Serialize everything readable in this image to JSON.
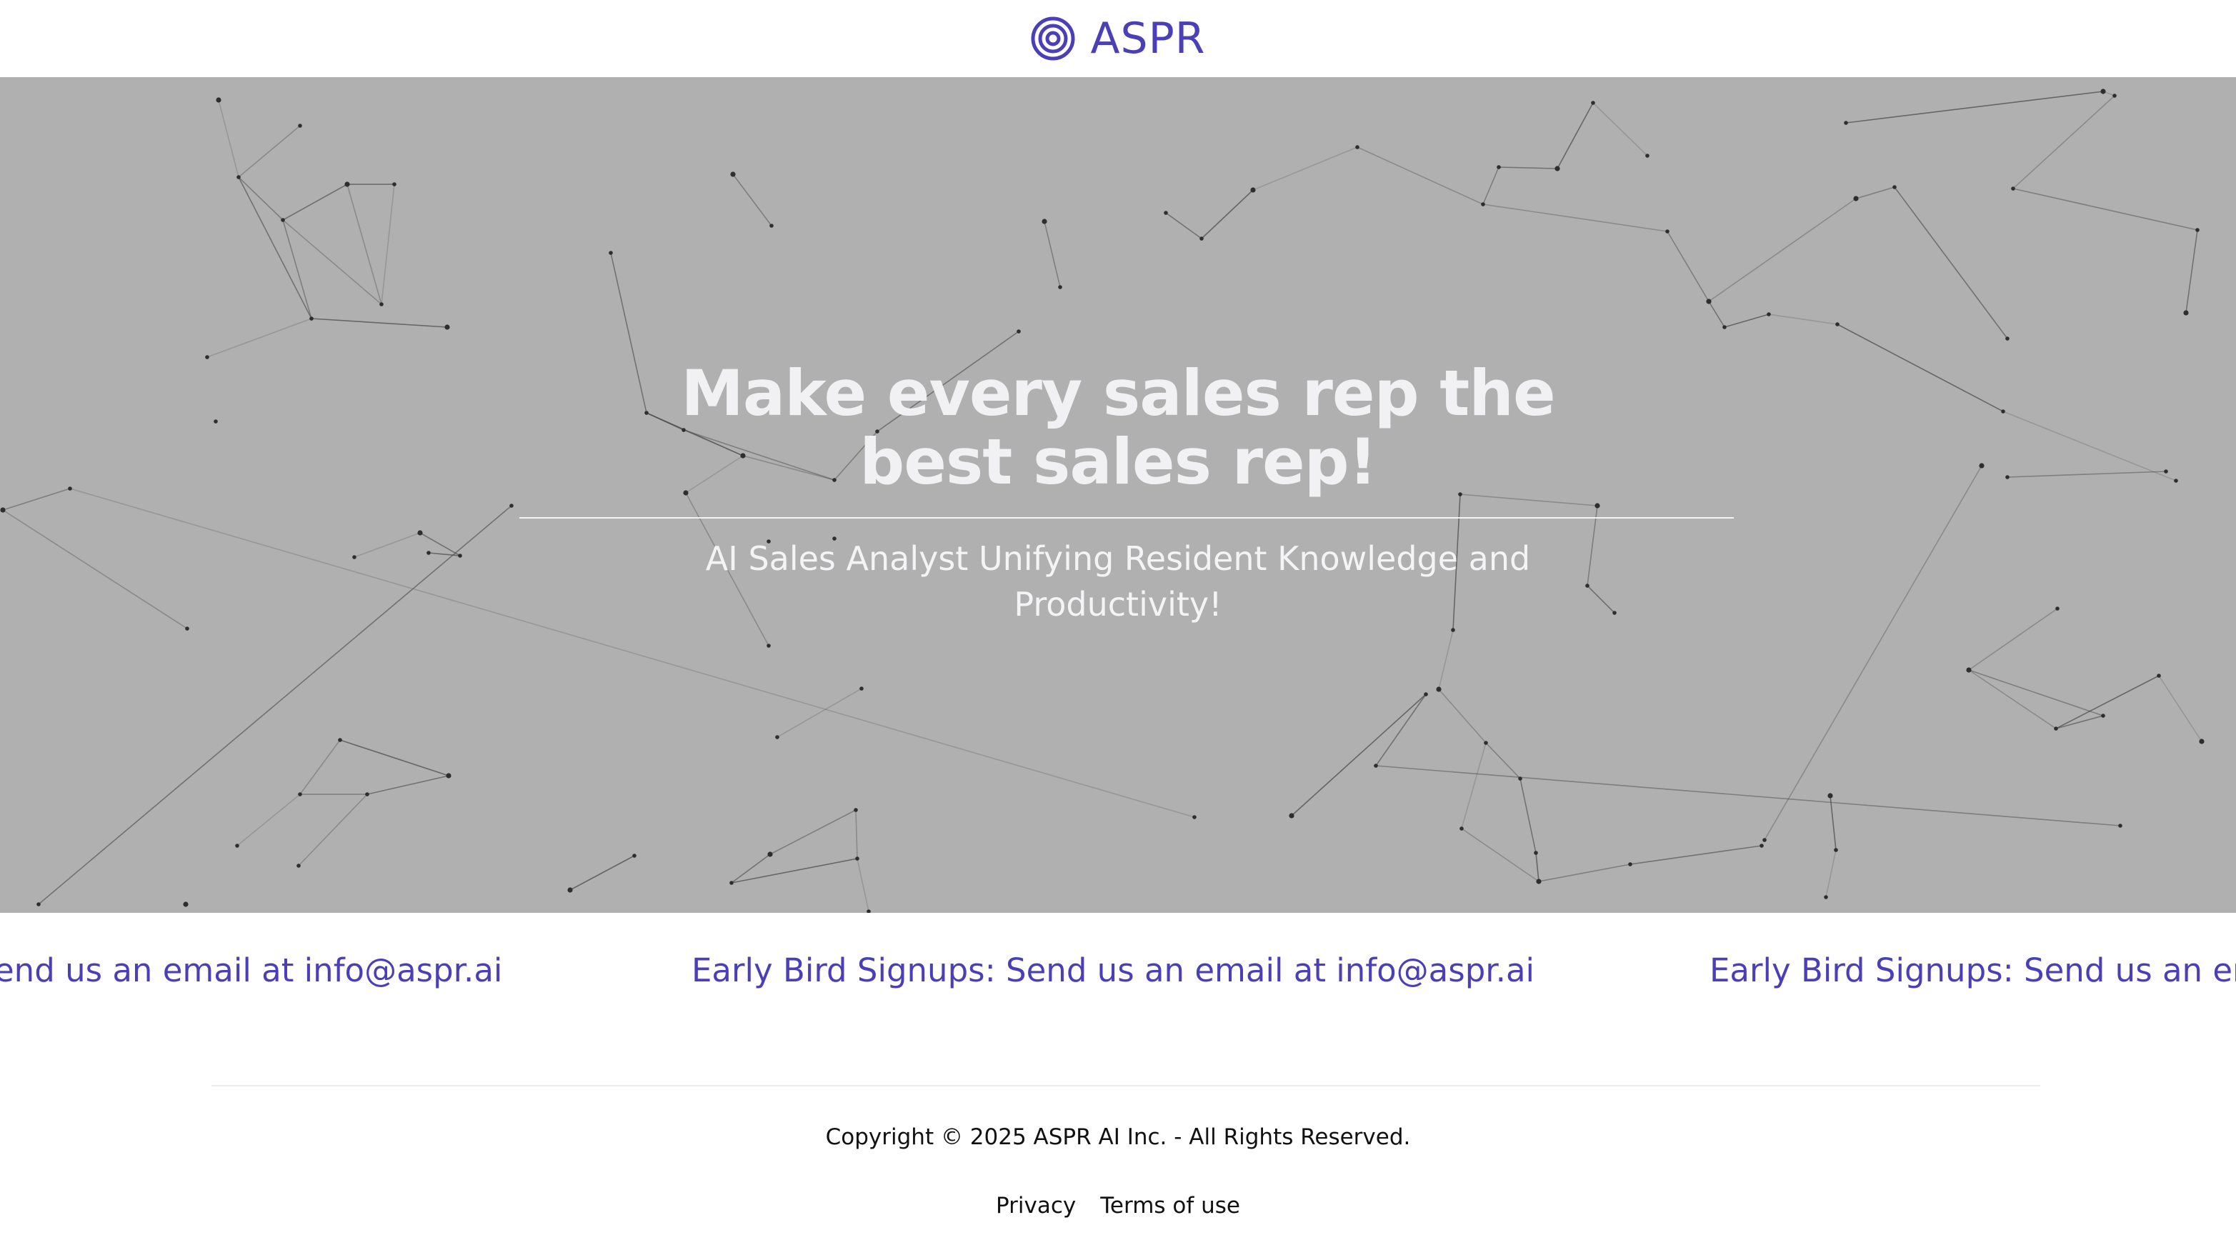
{
  "header": {
    "brand_name": "ASPR",
    "logo_icon": "concentric-target-icon"
  },
  "hero": {
    "title": "Make every sales rep the best sales rep!",
    "subtitle": "AI Sales Analyst Unifying Resident Knowledge and Productivity!",
    "background_decoration": "network-constellation"
  },
  "announcement": {
    "text": "Early Bird Signups: Send us an email at info@aspr.ai",
    "leading_fragment": "end us an email at info@aspr.ai",
    "trailing_fragment": "Early Bird Signups: Send us an ema"
  },
  "footer": {
    "copyright": "Copyright © 2025 ASPR AI Inc. - All Rights Reserved.",
    "links": [
      "Privacy",
      "Terms of use"
    ]
  },
  "colors": {
    "brand": "#4a3fb8",
    "hero_background": "#b0b0b0",
    "hero_text": "#f1f1f3",
    "link_text": "#111111"
  }
}
